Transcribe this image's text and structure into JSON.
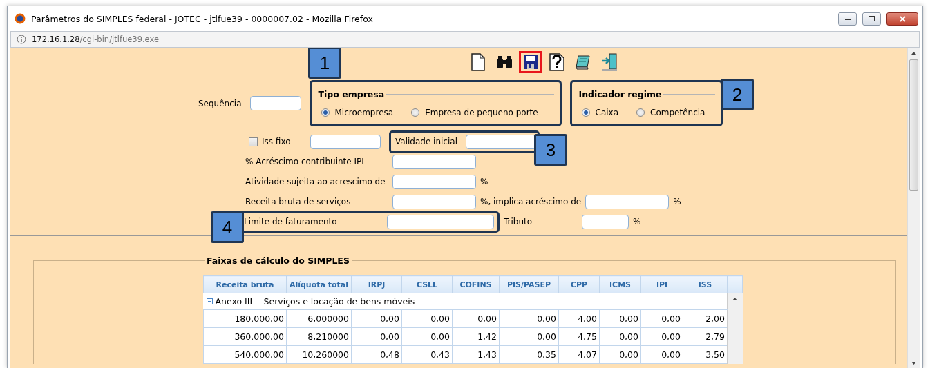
{
  "window": {
    "title": "Parâmetros do SIMPLES federal - JOTEC - jtlfue39 - 0000007.02 - Mozilla Firefox"
  },
  "address": {
    "host": "172.16.1.28",
    "path": "/cgi-bin/jtlfue39.exe"
  },
  "toolbar": [
    {
      "kind": "page",
      "highlighted": false
    },
    {
      "kind": "binoculars",
      "highlighted": false
    },
    {
      "kind": "floppy",
      "highlighted": true
    },
    {
      "kind": "help",
      "highlighted": false
    },
    {
      "kind": "notepad",
      "highlighted": false
    },
    {
      "kind": "exit",
      "highlighted": false
    }
  ],
  "toolbar_callout": "1",
  "sequencia": {
    "label": "Sequência"
  },
  "tipo_empresa": {
    "legend": "Tipo empresa",
    "options": [
      {
        "label": "Microempresa",
        "selected": true
      },
      {
        "label": "Empresa de pequeno porte",
        "selected": false
      }
    ]
  },
  "indicador_regime": {
    "legend": "Indicador regime",
    "callout": "2",
    "options": [
      {
        "label": "Caixa",
        "selected": true
      },
      {
        "label": "Competência",
        "selected": false
      }
    ]
  },
  "iss_fixo": {
    "label": "Iss fixo",
    "checked": false
  },
  "validade_inicial": {
    "label": "Validade inicial",
    "callout": "3"
  },
  "acrescimo_ipi": {
    "label": "% Acréscimo contribuinte IPI"
  },
  "atividade": {
    "label": "Atividade sujeita ao acrescimo de",
    "unit": "%"
  },
  "receita_servicos": {
    "label": "Receita bruta de serviços",
    "unit": "%, implica acréscimo de",
    "unit_2": "%"
  },
  "limite_faturamento": {
    "label": "Limite de faturamento",
    "callout": "4"
  },
  "tributo": {
    "label": "Tributo",
    "unit": "%"
  },
  "faixas": {
    "legend": "Faixas de cálculo do SIMPLES",
    "table": {
      "columns": [
        "Receita bruta",
        "Alíquota total",
        "IRPJ",
        "CSLL",
        "COFINS",
        "PIS/PASEP",
        "CPP",
        "ICMS",
        "IPI",
        "ISS"
      ],
      "groups": [
        {
          "label": "Anexo III -  Serviços e locação de bens móveis",
          "expanded": true,
          "rows": [
            [
              "180.000,00",
              "6,000000",
              "0,00",
              "0,00",
              "0,00",
              "0,00",
              "4,00",
              "0,00",
              "0,00",
              "2,00"
            ],
            [
              "360.000,00",
              "8,210000",
              "0,00",
              "0,00",
              "1,42",
              "0,00",
              "4,75",
              "0,00",
              "0,00",
              "2,79"
            ],
            [
              "540.000,00",
              "10,260000",
              "0,48",
              "0,43",
              "1,43",
              "0,35",
              "4,07",
              "0,00",
              "0,00",
              "3,50"
            ]
          ]
        }
      ]
    }
  }
}
